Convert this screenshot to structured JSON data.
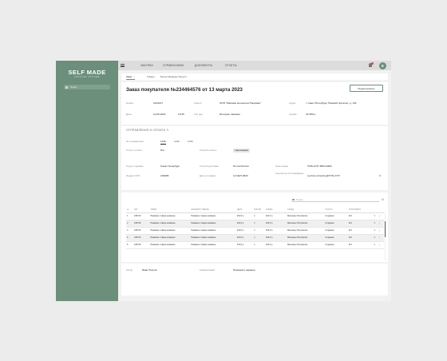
{
  "app": {
    "logo": "SELF MADE",
    "logo_sub": "CATALOG SYSTEM",
    "search_placeholder": "Поиск",
    "avatar_initial": "E"
  },
  "topnav": [
    "Закупки",
    "Справочники",
    "Документы",
    "Отчеты"
  ],
  "tabs": [
    {
      "label": "Заказ",
      "active": true,
      "close": "×"
    },
    {
      "label": "Товары",
      "active": false
    },
    {
      "label": "Белые Медведи Патрули",
      "active": false
    }
  ],
  "order": {
    "title": "Заказ покупателя №234464576 от 13 марта 2023",
    "edit_button": "Редактировать",
    "fields": {
      "number_label": "Номер",
      "number": "2134147",
      "client_label": "Клиент",
      "client": "ООО \"Магазин молока на Покровке\"",
      "address_label": "Адрес",
      "address": "г. Санкт-Петербург, Невский проспект, д. 131",
      "date_label": "Дата",
      "date": "12.09.2023",
      "time": "10:45",
      "channel_label": "Тип цен",
      "channel": "Интернет магазин",
      "sum_label": "Сумма",
      "sum": "34 380 р."
    }
  },
  "shipment": {
    "title": "Отправления и оплата",
    "title_icon": "✎",
    "dep_label": "№ отправления",
    "dep_tabs": [
      "1236",
      "1236",
      "1236"
    ],
    "status_label": "Статус оплаты",
    "status": "Нет",
    "method_label": "Способ оплаты",
    "method": "Наличными",
    "city_from_label": "Город отправки",
    "city_from": "Санкт-Петербург",
    "delivery_label": "Способ доставки",
    "delivery": "Почта России",
    "track_label": "Трек-номер",
    "track": "3736-2737-6594-9394",
    "code_label": "Индекс СПб",
    "code": "234695",
    "ship_date_label": "Дата отправки",
    "ship_date": "12 СЕН 2023",
    "link_label": "Ссылка на отслеживание",
    "link": "pochta.ru/tracking#3736-2737"
  },
  "table": {
    "search_placeholder": "Поиск",
    "columns": [
      "№",
      "Арт",
      "Товар",
      "Заказано товара",
      "Цена",
      "Кол-во",
      "Сумма",
      "Склад",
      "Статус",
      "Отгружено",
      ""
    ],
    "rows": [
      [
        "1",
        "235730",
        "Название товара название",
        "Название товара название",
        "234,5 р.",
        "1",
        "234,5 р.",
        "Магазины Петровских",
        "Создание",
        "213",
        "✎ ⋮"
      ],
      [
        "2",
        "235730",
        "Название товара название",
        "Название товара название",
        "234,5 р.",
        "1",
        "234,5 р.",
        "Магазины Петровских",
        "Создание",
        "213",
        "✎ ⋮"
      ],
      [
        "3",
        "235730",
        "Название товара название",
        "Название товара название",
        "234,5 р.",
        "1",
        "234,5 р.",
        "Магазины Петровских",
        "Создание",
        "213",
        "✎ ⋮"
      ],
      [
        "4",
        "235730",
        "Название товара название",
        "Название товара название",
        "234,5 р.",
        "1",
        "234,5 р.",
        "Магазины Петровских",
        "Создание",
        "213",
        "✎ ⋮"
      ],
      [
        "5",
        "235730",
        "Название товара название",
        "Название товара название",
        "234,5 р.",
        "1",
        "234,5 р.",
        "Магазины Петровских",
        "Создание",
        "213",
        "✎ ⋮"
      ]
    ]
  },
  "footer": {
    "author_label": "Автор",
    "author": "Иван Петров",
    "comment_label": "Комментарий",
    "comment": "Позвоните заранее"
  }
}
